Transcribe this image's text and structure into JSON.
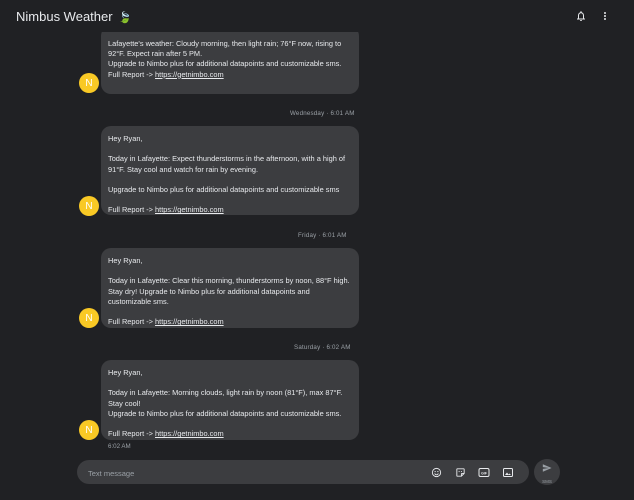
{
  "app": {
    "title": "Nimbus Weather",
    "title_emoji": "🍃"
  },
  "icons": {
    "notifications": "bell-icon",
    "menu": "more-vert-icon",
    "emoji": "emoji-icon",
    "sticker": "sticker-icon",
    "gif": "gif-icon",
    "image": "image-icon",
    "send": "send-icon"
  },
  "avatar": {
    "initial": "N",
    "color": "#f9c925"
  },
  "messages": [
    {
      "lines": [
        "Lafayette's weather: Cloudy morning, then light rain; 76°F now, rising to 92°F. Expect rain after 5 PM.",
        "Upgrade to Nimbo plus for additional datapoints and customizable sms.",
        ""
      ],
      "report_prefix": "Full Report -> ",
      "report_link": "https://getnimbo.com"
    },
    {
      "date": "Wednesday · 6:01 AM",
      "lines": [
        "Hey Ryan,",
        "",
        "Today in Lafayette: Expect thunderstorms in the afternoon, with a high of 91°F. Stay cool and watch for rain by evening.",
        "",
        "Upgrade to Nimbo plus for additional datapoints and customizable sms",
        ""
      ],
      "report_prefix": "Full Report -> ",
      "report_link": "https://getnimbo.com"
    },
    {
      "date": "Friday · 6:01 AM",
      "lines": [
        "Hey Ryan,",
        "",
        "Today in Lafayette: Clear this morning, thunderstorms by noon, 88°F high. Stay dry! Upgrade to Nimbo plus for additional datapoints and customizable sms.",
        ""
      ],
      "report_prefix": "Full Report -> ",
      "report_link": "https://getnimbo.com"
    },
    {
      "date": "Saturday · 6:02 AM",
      "lines": [
        "Hey Ryan,",
        "",
        "Today in Lafayette: Morning clouds, light rain by noon (81°F), max 87°F. Stay cool!",
        "Upgrade to Nimbo plus for additional datapoints and customizable sms.",
        ""
      ],
      "report_prefix": "Full Report -> ",
      "report_link": "https://getnimbo.com",
      "time_after": "6:02 AM"
    }
  ],
  "composer": {
    "placeholder": "Text message",
    "send_label": "SMS"
  }
}
